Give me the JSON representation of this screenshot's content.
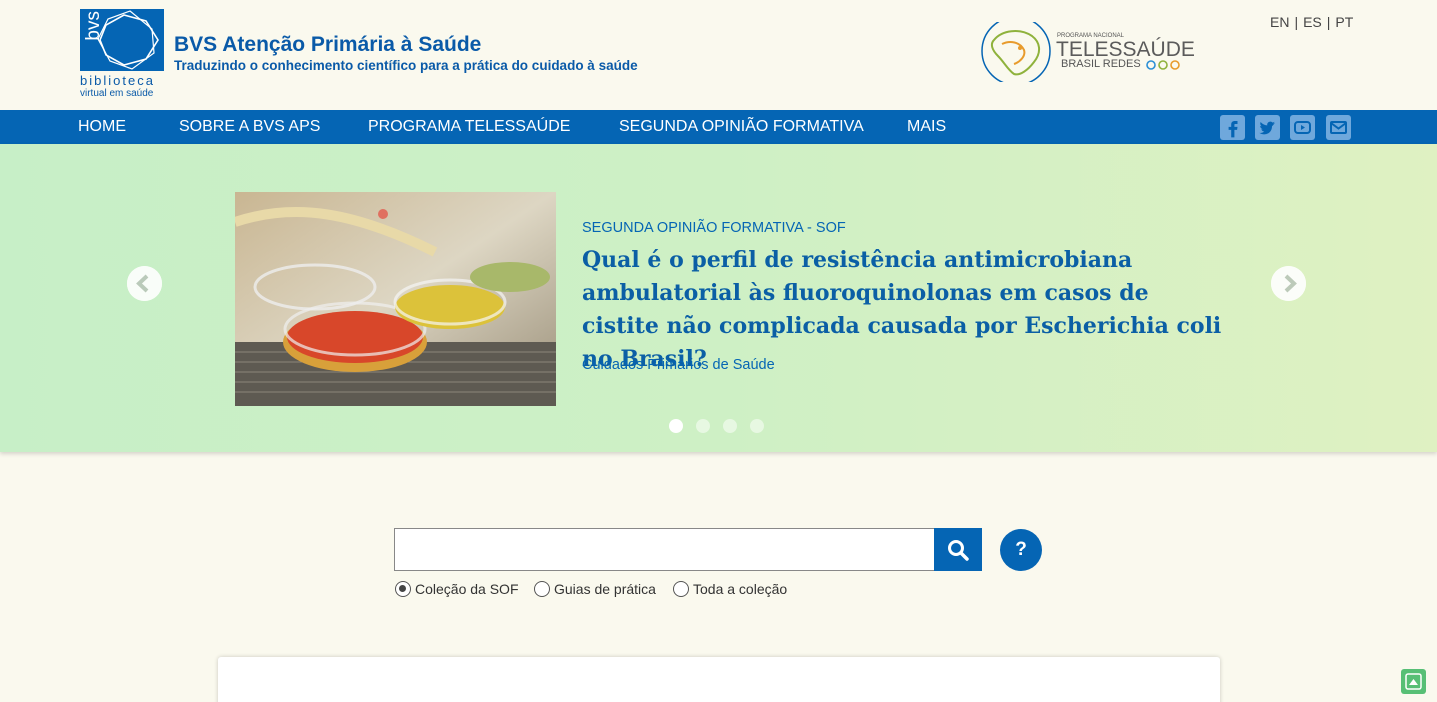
{
  "header": {
    "logo_text": "bvs",
    "logo_sub1": "biblioteca",
    "logo_sub2": "virtual em saúde",
    "title": "BVS Atenção Primária à Saúde",
    "tagline": "Traduzindo o conhecimento científico para a prática do cuidado à saúde",
    "partner_logo": {
      "small": "PROGRAMA NACIONAL",
      "big": "TELESSAÚDE",
      "sub": "BRASIL REDES"
    },
    "languages": [
      "EN",
      "ES",
      "PT"
    ]
  },
  "nav": {
    "items": [
      {
        "label": "HOME"
      },
      {
        "label": "SOBRE A BVS APS"
      },
      {
        "label": "PROGRAMA TELESSAÚDE"
      },
      {
        "label": "SEGUNDA OPINIÃO FORMATIVA"
      },
      {
        "label": "MAIS"
      }
    ],
    "social_icons": [
      "facebook-icon",
      "twitter-icon",
      "youtube-icon",
      "email-icon"
    ]
  },
  "carousel": {
    "category": "SEGUNDA OPINIÃO FORMATIVA - SOF",
    "title": "Qual é o perfil de resistência antimicrobiana ambulatorial às fluoroquinolonas em casos de cistite não complicada causada por Escherichia coli no Brasil?",
    "tag": "Cuidados Primários de Saúde",
    "slide_count": 4,
    "active_slide": 1
  },
  "search": {
    "placeholder": "",
    "value": "",
    "help_label": "?",
    "options": [
      {
        "label": "Coleção da SOF",
        "checked": true
      },
      {
        "label": "Guias de prática",
        "checked": false
      },
      {
        "label": "Toda a coleção",
        "checked": false
      }
    ]
  },
  "colors": {
    "primary": "#0565b4",
    "background": "#faf9ee",
    "back_to_top": "#57bf75"
  }
}
